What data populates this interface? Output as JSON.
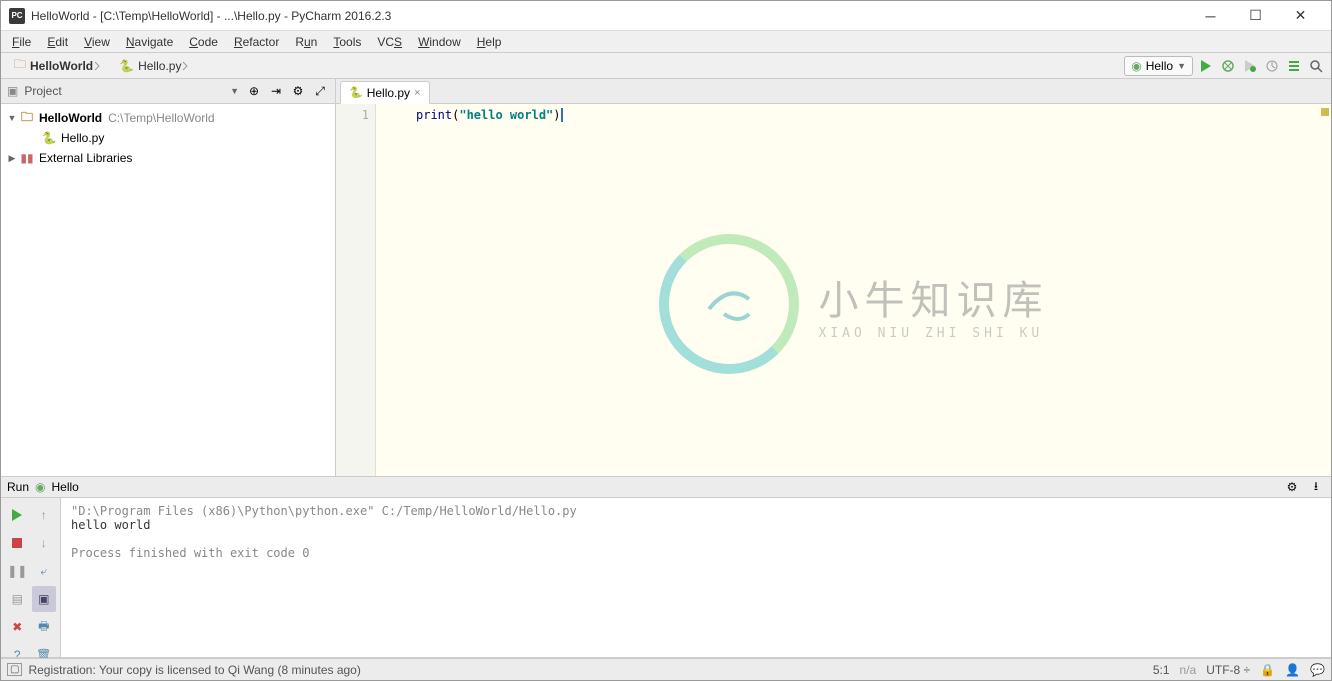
{
  "title": "HelloWorld - [C:\\Temp\\HelloWorld] - ...\\Hello.py - PyCharm 2016.2.3",
  "menu": {
    "file": "File",
    "edit": "Edit",
    "view": "View",
    "navigate": "Navigate",
    "code": "Code",
    "refactor": "Refactor",
    "run": "Run",
    "tools": "Tools",
    "vcs": "VCS",
    "window": "Window",
    "help": "Help"
  },
  "breadcrumb": {
    "project": "HelloWorld",
    "file": "Hello.py"
  },
  "runconfig": "Hello",
  "sidebar": {
    "title": "Project",
    "tree": {
      "root": {
        "name": "HelloWorld",
        "path": "C:\\Temp\\HelloWorld"
      },
      "file": "Hello.py",
      "external": "External Libraries"
    }
  },
  "editor": {
    "tab": "Hello.py",
    "line_no": "1",
    "code": {
      "fn": "print",
      "str": "\"hello world\""
    }
  },
  "watermark": {
    "cn": "小牛知识库",
    "en": "XIAO NIU ZHI SHI KU"
  },
  "runpanel": {
    "label": "Run",
    "name": "Hello",
    "cmd": "\"D:\\Program Files (x86)\\Python\\python.exe\" C:/Temp/HelloWorld/Hello.py",
    "out": "hello world",
    "exit": "Process finished with exit code 0"
  },
  "status": {
    "registration": "Registration: Your copy is licensed to Qi Wang (8 minutes ago)",
    "pos": "5:1",
    "insert": "n/a",
    "encoding": "UTF-8"
  }
}
